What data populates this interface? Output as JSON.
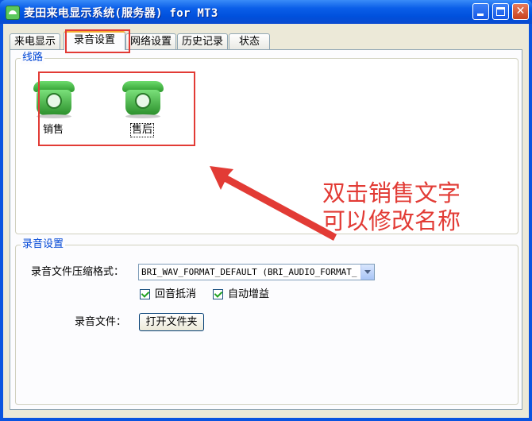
{
  "window": {
    "title": "麦田来电显示系统(服务器) for MT3"
  },
  "tabs": [
    {
      "label": "来电显示"
    },
    {
      "label": "录音设置"
    },
    {
      "label": "网络设置"
    },
    {
      "label": "历史记录"
    },
    {
      "label": "状态"
    }
  ],
  "lines_group": {
    "title": "线路",
    "lines": [
      {
        "label": "销售"
      },
      {
        "label": "售后"
      }
    ]
  },
  "annotation": {
    "line1": "双击销售文字",
    "line2": "可以修改名称",
    "color": "#e23b35"
  },
  "recording_group": {
    "title": "录音设置",
    "format_label": "录音文件压缩格式：",
    "format_value": "BRI_WAV_FORMAT_DEFAULT (BRI_AUDIO_FORMAT_",
    "echo_cancel_label": "回音抵消",
    "echo_cancel_checked": true,
    "auto_gain_label": "自动增益",
    "auto_gain_checked": true,
    "file_label": "录音文件：",
    "open_folder_label": "打开文件夹"
  },
  "colors": {
    "titlebar": "#0a54e0",
    "dialog_bg": "#ece9d8",
    "group_title": "#0046d5",
    "highlight_box": "#e23b35"
  },
  "icons": [
    "app-phone-icon",
    "minimize-icon",
    "maximize-icon",
    "close-icon",
    "telephone-icon",
    "chevron-down-icon",
    "checkmark-icon"
  ]
}
